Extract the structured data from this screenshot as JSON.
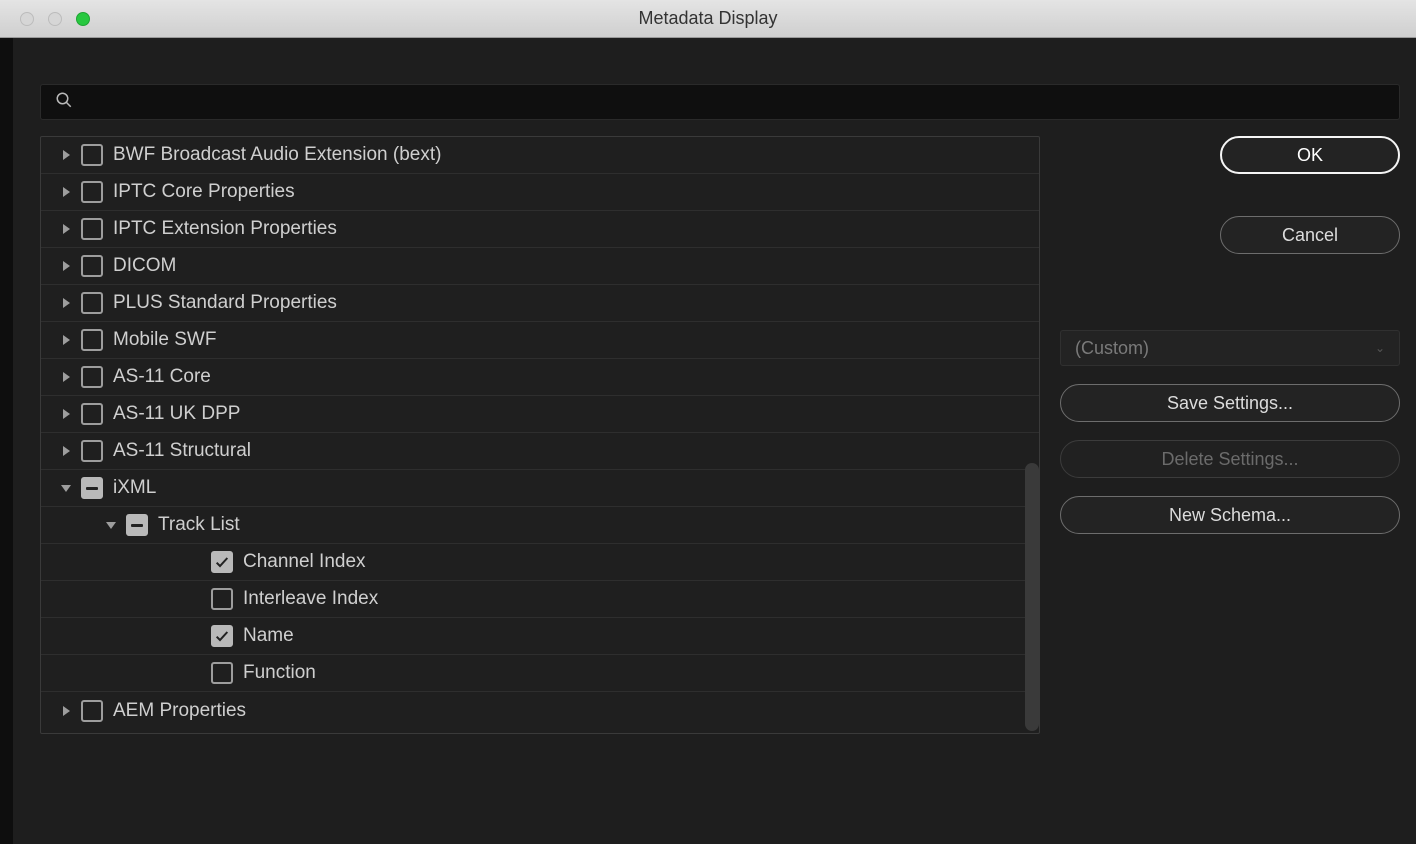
{
  "title": "Metadata Display",
  "search": {
    "placeholder": ""
  },
  "tree": [
    {
      "label": "BWF Broadcast Audio Extension (bext)",
      "check": "unchecked",
      "disclosure": "right",
      "indent": 0
    },
    {
      "label": "IPTC Core Properties",
      "check": "unchecked",
      "disclosure": "right",
      "indent": 0
    },
    {
      "label": "IPTC Extension Properties",
      "check": "unchecked",
      "disclosure": "right",
      "indent": 0
    },
    {
      "label": "DICOM",
      "check": "unchecked",
      "disclosure": "right",
      "indent": 0
    },
    {
      "label": "PLUS Standard Properties",
      "check": "unchecked",
      "disclosure": "right",
      "indent": 0
    },
    {
      "label": "Mobile SWF",
      "check": "unchecked",
      "disclosure": "right",
      "indent": 0
    },
    {
      "label": "AS-11 Core",
      "check": "unchecked",
      "disclosure": "right",
      "indent": 0
    },
    {
      "label": "AS-11 UK DPP",
      "check": "unchecked",
      "disclosure": "right",
      "indent": 0
    },
    {
      "label": "AS-11 Structural",
      "check": "unchecked",
      "disclosure": "right",
      "indent": 0
    },
    {
      "label": "iXML",
      "check": "indeterminate",
      "disclosure": "down",
      "indent": 0
    },
    {
      "label": "Track List",
      "check": "indeterminate",
      "disclosure": "down",
      "indent": 1
    },
    {
      "label": "Channel Index",
      "check": "checked",
      "disclosure": "none",
      "indent": 2
    },
    {
      "label": "Interleave Index",
      "check": "unchecked",
      "disclosure": "none",
      "indent": 2
    },
    {
      "label": "Name",
      "check": "checked",
      "disclosure": "none",
      "indent": 2
    },
    {
      "label": "Function",
      "check": "unchecked",
      "disclosure": "none",
      "indent": 2
    },
    {
      "label": "AEM Properties",
      "check": "unchecked",
      "disclosure": "right",
      "indent": 0
    }
  ],
  "buttons": {
    "ok": "OK",
    "cancel": "Cancel",
    "preset": "(Custom)",
    "save": "Save Settings...",
    "delete": "Delete Settings...",
    "newSchema": "New Schema..."
  }
}
